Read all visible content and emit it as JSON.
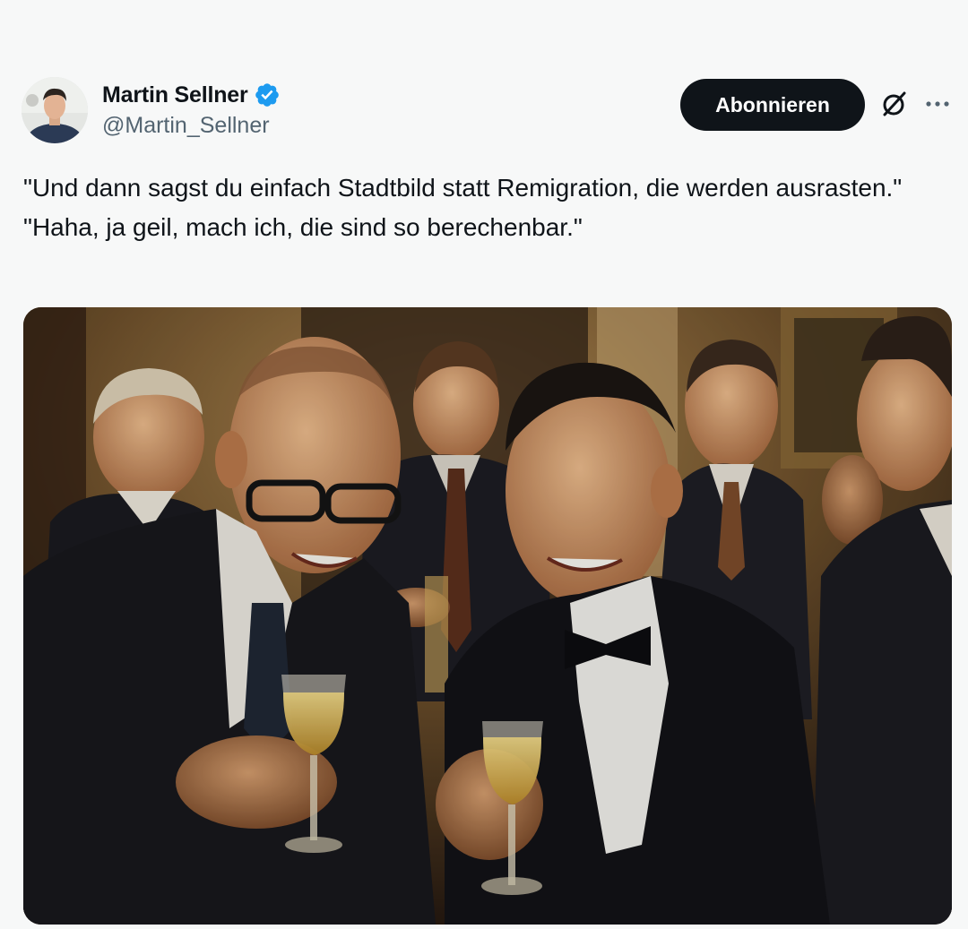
{
  "author": {
    "display_name": "Martin Sellner",
    "handle": "@Martin_Sellner",
    "verified": true,
    "verified_color": "#1d9bf0"
  },
  "actions": {
    "follow_label": "Abonnieren",
    "grok_icon": "slashed-circle-icon",
    "more_icon": "more-horizontal-icon"
  },
  "tweet": {
    "text_line1": "\"Und dann sagst du einfach Stadtbild statt Remigration, die werden ausrasten.\"",
    "text_line2": "\"Haha, ja geil, mach ich, die sind so berechenbar.\""
  },
  "media": {
    "type": "photo",
    "image_label": "photo-of-men-laughing-with-champagne-glasses"
  },
  "colors": {
    "background": "#f7f8f8",
    "text_primary": "#0f1419",
    "text_secondary": "#536471",
    "button_bg": "#0f1419"
  }
}
